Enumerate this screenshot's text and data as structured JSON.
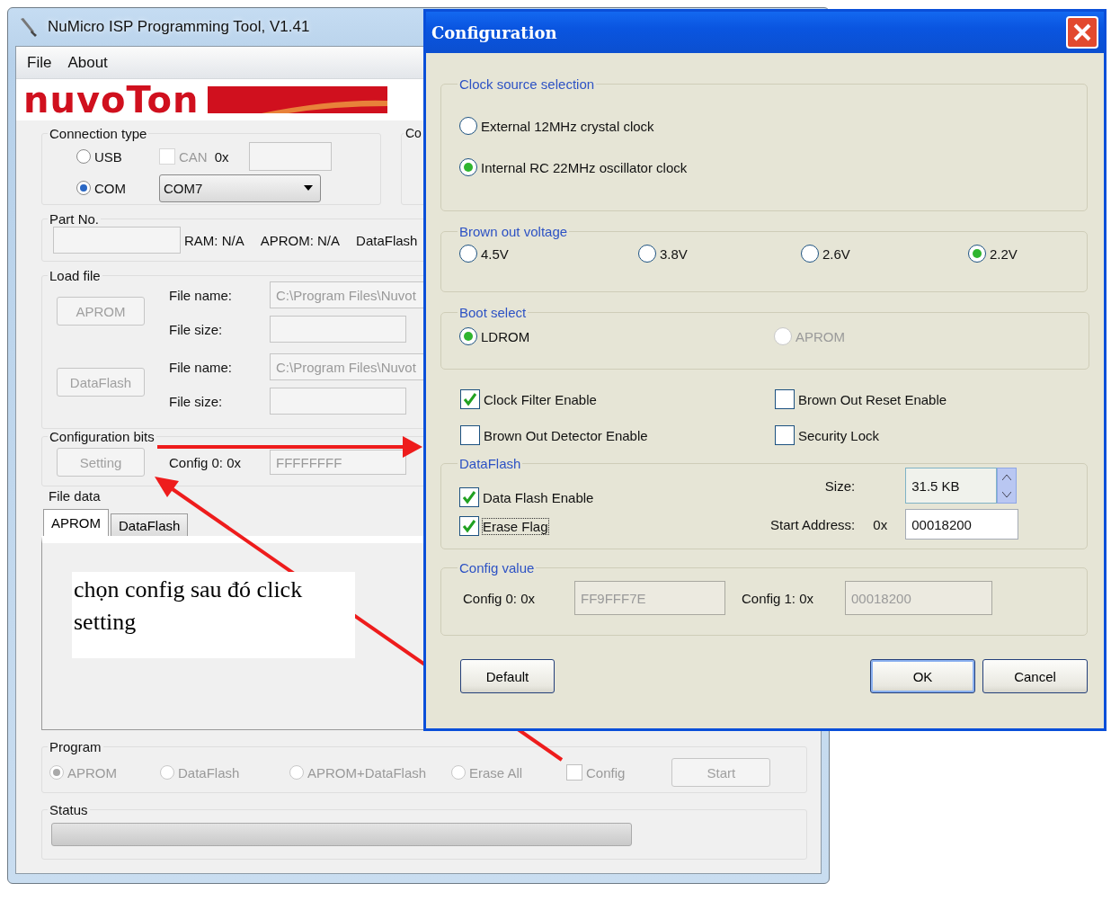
{
  "main_window": {
    "title": "NuMicro ISP Programming Tool, V1.41",
    "menu": [
      "File",
      "About"
    ],
    "logo": "nuvoTon",
    "connection": {
      "label": "Connection type",
      "options": [
        {
          "label": "USB",
          "selected": false
        },
        {
          "label": "COM",
          "selected": true
        }
      ],
      "can": {
        "label": "CAN",
        "checked": false,
        "disabled": true
      },
      "can_prefix": "0x",
      "port": "COM7"
    },
    "cut_group_label": "Co",
    "part_no": {
      "label": "Part No.",
      "info": [
        "RAM: N/A",
        "APROM: N/A",
        "DataFlash"
      ]
    },
    "load_file": {
      "label": "Load file",
      "rows": [
        {
          "button": "APROM",
          "disabled": true,
          "name_label": "File name:",
          "name_value": "C:\\Program Files\\Nuvot",
          "size_label": "File size:"
        },
        {
          "button": "DataFlash",
          "disabled": true,
          "name_label": "File name:",
          "name_value": "C:\\Program Files\\Nuvot",
          "size_label": "File size:"
        }
      ]
    },
    "config_bits": {
      "label": "Configuration bits",
      "button": "Setting",
      "disabled": true,
      "config_label": "Config 0: 0x",
      "value": "FFFFFFFF"
    },
    "file_data": {
      "label": "File data",
      "tabs": [
        {
          "label": "APROM",
          "selected": true
        },
        {
          "label": "DataFlash",
          "selected": false
        }
      ]
    },
    "program": {
      "label": "Program",
      "options": [
        {
          "label": "APROM",
          "selected": true
        },
        {
          "label": "DataFlash",
          "selected": false
        },
        {
          "label": "APROM+DataFlash",
          "selected": false
        },
        {
          "label": "Erase All",
          "selected": false
        }
      ],
      "disabled": true,
      "config": {
        "label": "Config",
        "checked": false
      },
      "start": "Start"
    },
    "status": {
      "label": "Status",
      "level": 0
    }
  },
  "note": "chọn config sau đó click setting",
  "dialog": {
    "title": "Configuration",
    "clock": {
      "label": "Clock source selection",
      "options": [
        {
          "label": "External 12MHz crystal clock",
          "selected": false
        },
        {
          "label": "Internal RC 22MHz oscillator clock",
          "selected": true
        }
      ]
    },
    "brown_out": {
      "label": "Brown out voltage",
      "options": [
        {
          "label": "4.5V",
          "selected": false
        },
        {
          "label": "3.8V",
          "selected": false
        },
        {
          "label": "2.6V",
          "selected": false
        },
        {
          "label": "2.2V",
          "selected": true
        }
      ]
    },
    "boot": {
      "label": "Boot select",
      "options": [
        {
          "label": "LDROM",
          "selected": true,
          "disabled": false
        },
        {
          "label": "APROM",
          "selected": false,
          "disabled": true
        }
      ]
    },
    "checks": [
      {
        "label": "Clock Filter Enable",
        "checked": true
      },
      {
        "label": "Brown Out Reset Enable",
        "checked": false
      },
      {
        "label": "Brown Out Detector Enable",
        "checked": false
      },
      {
        "label": "Security Lock",
        "checked": false
      }
    ],
    "dataflash": {
      "label": "DataFlash",
      "enable": {
        "label": "Data Flash Enable",
        "checked": true
      },
      "erase": {
        "label": "Erase Flag",
        "checked": true
      },
      "size_label": "Size:",
      "size": "31.5 KB",
      "start_label": "Start Address:",
      "prefix": "0x",
      "start": "00018200"
    },
    "config_value": {
      "label": "Config value",
      "items": [
        {
          "label": "Config 0: 0x",
          "value": "FF9FFF7E"
        },
        {
          "label": "Config 1: 0x",
          "value": "00018200"
        }
      ]
    },
    "buttons": {
      "default": "Default",
      "ok": "OK",
      "cancel": "Cancel"
    }
  }
}
